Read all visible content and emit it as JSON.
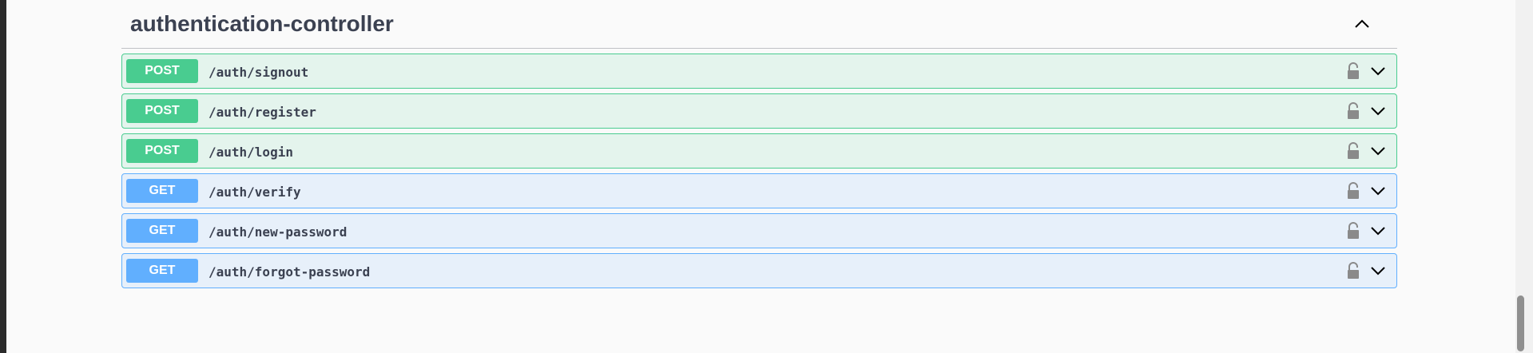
{
  "section": {
    "title": "authentication-controller",
    "collapse_icon": "chevron-up-icon"
  },
  "operations": [
    {
      "method": "POST",
      "path": "/auth/signout"
    },
    {
      "method": "POST",
      "path": "/auth/register"
    },
    {
      "method": "POST",
      "path": "/auth/login"
    },
    {
      "method": "GET",
      "path": "/auth/verify"
    },
    {
      "method": "GET",
      "path": "/auth/new-password"
    },
    {
      "method": "GET",
      "path": "/auth/forgot-password"
    }
  ],
  "icons": {
    "lock": "unlocked-lock-icon",
    "expand": "chevron-down-icon"
  },
  "colors": {
    "post": "#49cc90",
    "get": "#61affe",
    "text": "#3b4151"
  }
}
